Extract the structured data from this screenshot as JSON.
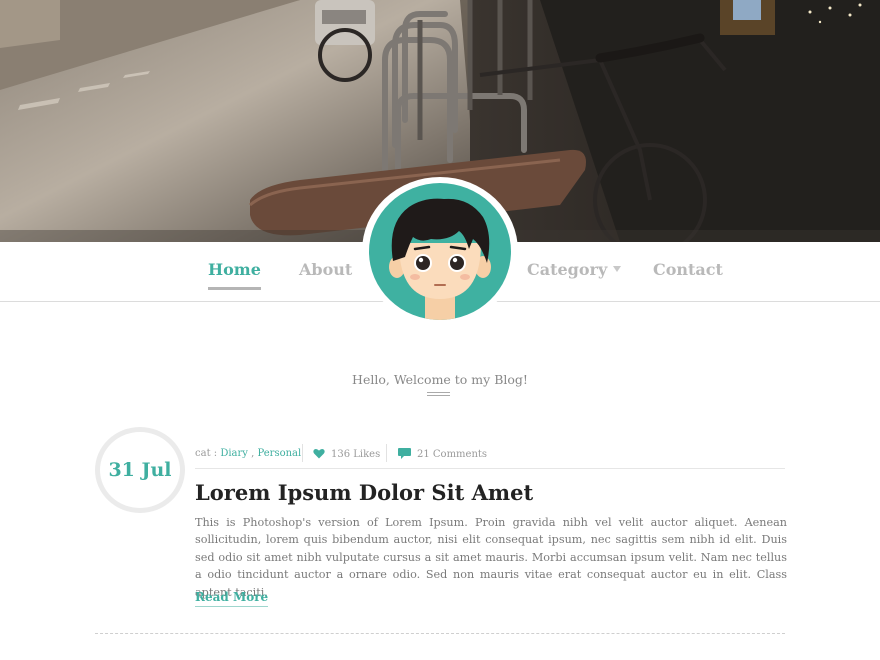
{
  "nav": {
    "items": [
      {
        "label": "Home",
        "active": true
      },
      {
        "label": "About",
        "active": false
      },
      {
        "label": "Category",
        "active": false
      },
      {
        "label": "Contact",
        "active": false
      }
    ]
  },
  "welcome": {
    "text": "Hello, Welcome to my Blog!"
  },
  "post": {
    "date": "31 Jul",
    "cat_prefix": "cat : ",
    "categories": [
      "Diary",
      "Personal"
    ],
    "category_separator": " , ",
    "likes": "136 Likes",
    "comments": "21 Comments",
    "title": "Lorem Ipsum Dolor Sit Amet",
    "body": "This is Photoshop's version  of Lorem Ipsum. Proin gravida nibh vel velit auctor aliquet. Aenean sollicitudin, lorem quis bibendum auctor, nisi elit consequat ipsum, nec sagittis sem nibh id elit. Duis sed odio sit amet nibh vulputate cursus a sit amet mauris. Morbi accumsan ipsum velit. Nam nec tellus a odio tincidunt auctor a ornare odio. Sed non  mauris vitae erat consequat auctor eu in elit. Class aptent taciti.",
    "read_more": "Read More"
  },
  "colors": {
    "accent": "#3fafa0",
    "nav_inactive": "#b9b9b9",
    "title": "#232323",
    "body_text": "#7a7a7a"
  },
  "icons": {
    "likes": "heart-icon",
    "comments": "speech-bubble-icon",
    "category_dropdown": "caret-down-icon"
  }
}
